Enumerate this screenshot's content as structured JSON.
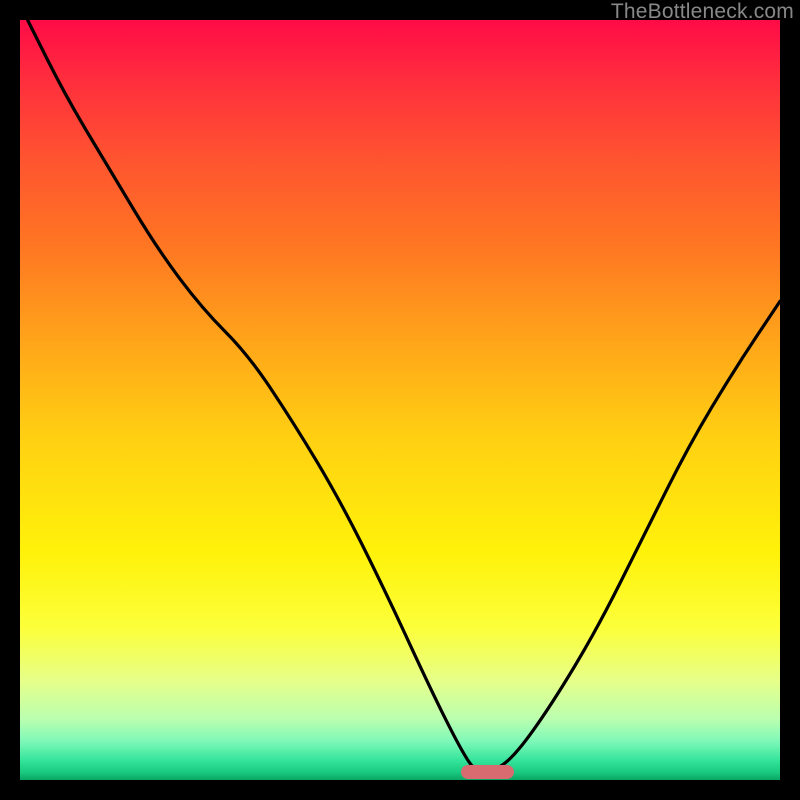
{
  "watermark": "TheBottleneck.com",
  "colors": {
    "page_bg": "#000000",
    "curve": "#000000",
    "marker": "#d76b6f",
    "gradient_top": "#ff0b47",
    "gradient_bottom": "#0aa562"
  },
  "chart_data": {
    "type": "line",
    "title": "",
    "xlabel": "",
    "ylabel": "",
    "xlim": [
      0,
      100
    ],
    "ylim": [
      0,
      100
    ],
    "grid": false,
    "series": [
      {
        "name": "bottleneck-curve",
        "x": [
          1,
          6,
          12,
          18,
          24,
          30,
          36,
          42,
          48,
          54,
          58,
          60,
          62,
          65,
          70,
          76,
          82,
          88,
          94,
          100
        ],
        "values": [
          100,
          90,
          80,
          70,
          62,
          56,
          47,
          37,
          25,
          12,
          4,
          1,
          1,
          3,
          10,
          20,
          32,
          44,
          54,
          63
        ]
      }
    ],
    "annotations": [
      {
        "name": "optimal-marker",
        "x_start": 58,
        "x_end": 65,
        "y": 0
      }
    ]
  }
}
